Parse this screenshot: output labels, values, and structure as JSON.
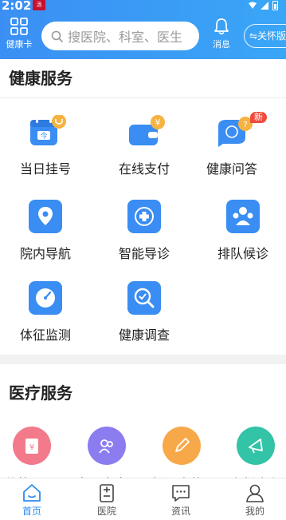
{
  "status": {
    "time": "2:02",
    "app_badge": "汤"
  },
  "header": {
    "health_card_label": "健康卡",
    "search_placeholder": "搜医院、科室、医生",
    "message_label": "消息",
    "care_mode_label": "⇋关怀版"
  },
  "health_services": {
    "title": "健康服务",
    "new_badge": "新",
    "items": [
      {
        "label": "当日挂号",
        "icon": "calendar-stethoscope-icon"
      },
      {
        "label": "在线支付",
        "icon": "wallet-yuan-icon"
      },
      {
        "label": "健康问答",
        "icon": "chat-question-icon"
      },
      {
        "label": "院内导航",
        "icon": "map-pin-icon"
      },
      {
        "label": "智能导诊",
        "icon": "medical-target-icon"
      },
      {
        "label": "排队候诊",
        "icon": "people-queue-icon"
      },
      {
        "label": "体征监测",
        "icon": "gauge-icon"
      },
      {
        "label": "健康调查",
        "icon": "magnifier-check-icon"
      }
    ]
  },
  "medical_services": {
    "title": "医疗服务",
    "items": [
      {
        "label": "价格公示",
        "icon": "price-board-icon",
        "color": "#f27a8a"
      },
      {
        "label": "名医专家",
        "icon": "doctors-icon",
        "color": "#8b7cf0"
      },
      {
        "label": "新冠疫苗",
        "icon": "pen-icon",
        "color": "#f7a94a"
      },
      {
        "label": "重症活动",
        "icon": "horn-icon",
        "color": "#33c3a6"
      }
    ]
  },
  "tabbar": {
    "items": [
      {
        "label": "首页",
        "icon": "home-icon",
        "active": true
      },
      {
        "label": "医院",
        "icon": "hospital-icon",
        "active": false
      },
      {
        "label": "资讯",
        "icon": "news-icon",
        "active": false
      },
      {
        "label": "我的",
        "icon": "profile-icon",
        "active": false
      }
    ]
  },
  "colors": {
    "primary": "#3b8ff4",
    "icon_blue": "#3a8df2",
    "icon_orange": "#f5b342",
    "new_badge": "#f04b3c"
  }
}
